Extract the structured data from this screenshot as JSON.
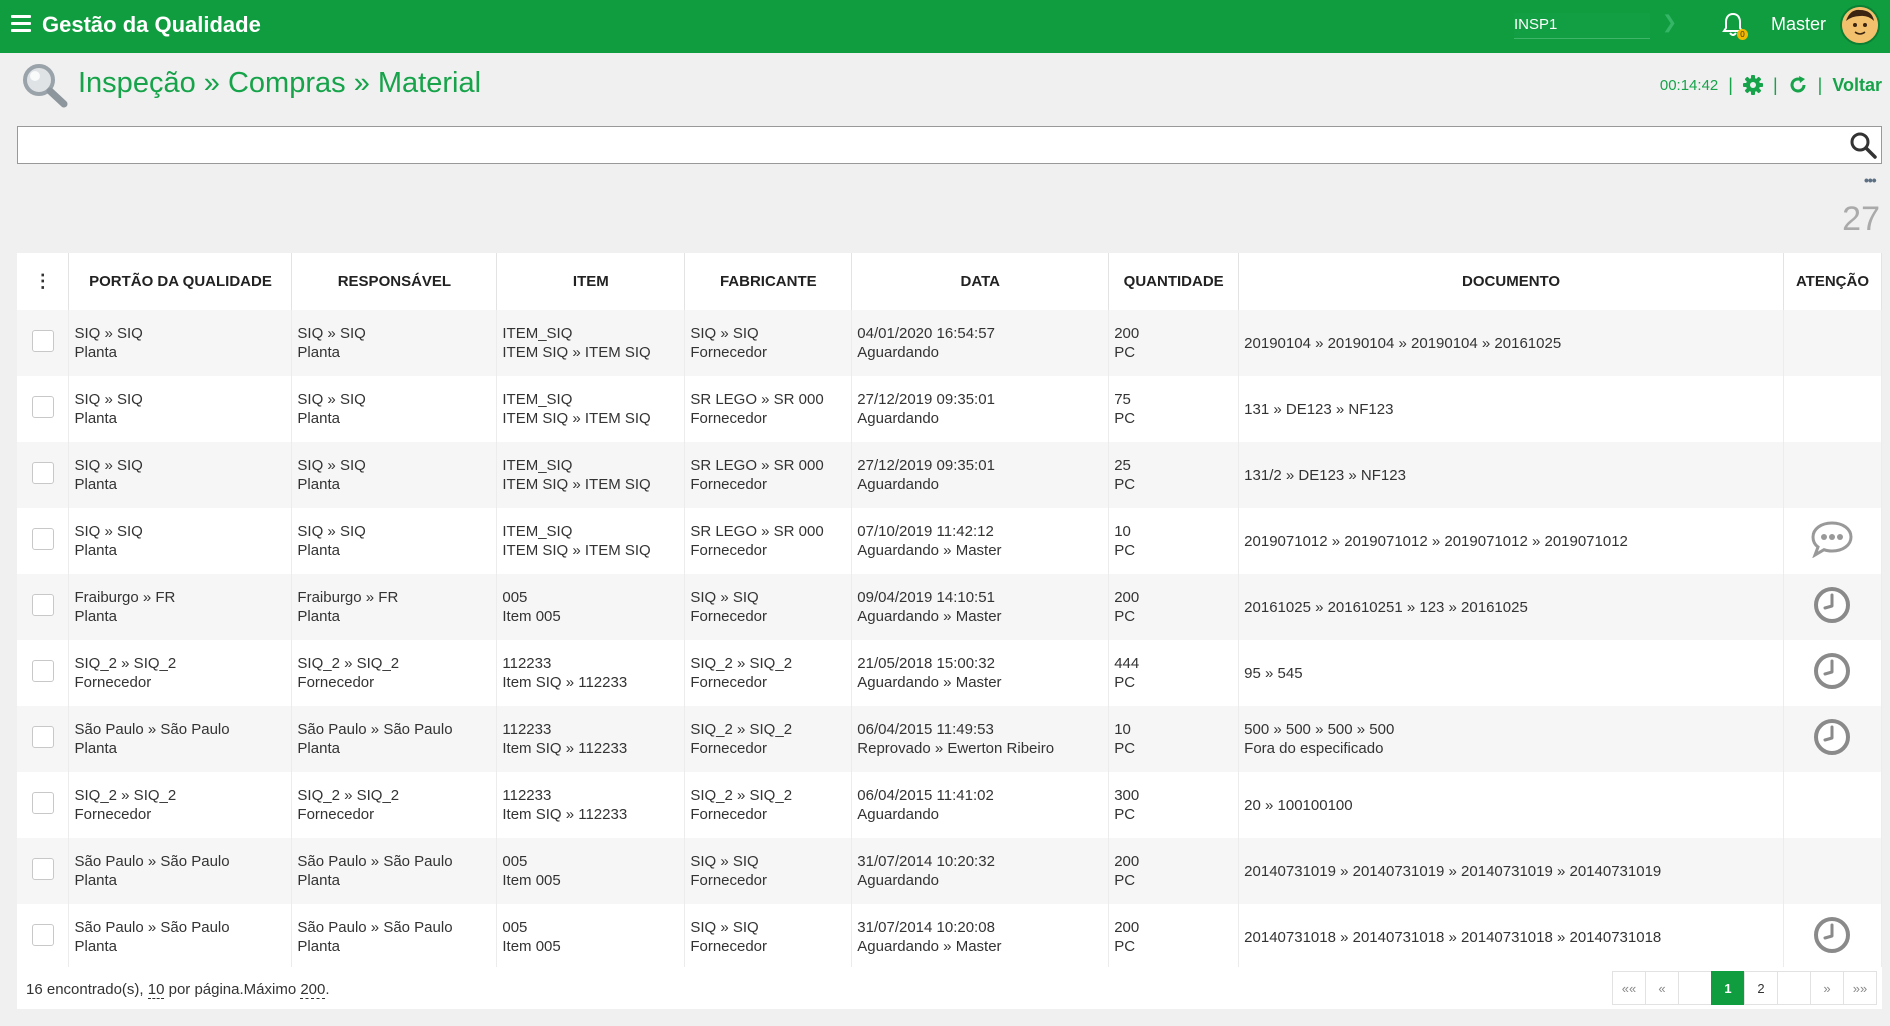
{
  "app": {
    "title": "Gestão da Qualidade"
  },
  "topbar": {
    "context": "INSP1",
    "user": "Master",
    "notifications": "0"
  },
  "breadcrumb": {
    "parts": [
      "Inspeção",
      "Compras",
      "Material"
    ],
    "separator": "»"
  },
  "header": {
    "timer": "00:14:42",
    "sep": "|",
    "back_label": "Voltar"
  },
  "search": {
    "placeholder": "",
    "value": ""
  },
  "more": "•••",
  "total_count": "27",
  "table": {
    "menu_glyph": "⋮",
    "columns": [
      "PORTÃO DA QUALIDADE",
      "RESPONSÁVEL",
      "ITEM",
      "FABRICANTE",
      "DATA",
      "QUANTIDADE",
      "DOCUMENTO",
      "ATENÇÃO"
    ],
    "rows": [
      {
        "portao": [
          "SIQ » SIQ",
          "Planta"
        ],
        "responsavel": [
          "SIQ » SIQ",
          "Planta"
        ],
        "item": [
          "ITEM_SIQ",
          "ITEM SIQ » ITEM SIQ"
        ],
        "fabricante": [
          "SIQ » SIQ",
          "Fornecedor"
        ],
        "data": [
          "04/01/2020 16:54:57",
          "Aguardando"
        ],
        "quantidade": [
          "200",
          "PC"
        ],
        "documento": [
          "20190104 » 20190104 » 20190104 » 20161025"
        ],
        "atencao": ""
      },
      {
        "portao": [
          "SIQ » SIQ",
          "Planta"
        ],
        "responsavel": [
          "SIQ » SIQ",
          "Planta"
        ],
        "item": [
          "ITEM_SIQ",
          "ITEM SIQ » ITEM SIQ"
        ],
        "fabricante": [
          "SR LEGO » SR 000",
          "Fornecedor"
        ],
        "data": [
          "27/12/2019 09:35:01",
          "Aguardando"
        ],
        "quantidade": [
          "75",
          "PC"
        ],
        "documento": [
          "131 » DE123 » NF123"
        ],
        "atencao": ""
      },
      {
        "portao": [
          "SIQ » SIQ",
          "Planta"
        ],
        "responsavel": [
          "SIQ » SIQ",
          "Planta"
        ],
        "item": [
          "ITEM_SIQ",
          "ITEM SIQ » ITEM SIQ"
        ],
        "fabricante": [
          "SR LEGO » SR 000",
          "Fornecedor"
        ],
        "data": [
          "27/12/2019 09:35:01",
          "Aguardando"
        ],
        "quantidade": [
          "25",
          "PC"
        ],
        "documento": [
          "131/2 » DE123 » NF123"
        ],
        "atencao": ""
      },
      {
        "portao": [
          "SIQ » SIQ",
          "Planta"
        ],
        "responsavel": [
          "SIQ » SIQ",
          "Planta"
        ],
        "item": [
          "ITEM_SIQ",
          "ITEM SIQ » ITEM SIQ"
        ],
        "fabricante": [
          "SR LEGO » SR 000",
          "Fornecedor"
        ],
        "data": [
          "07/10/2019 11:42:12",
          "Aguardando » Master"
        ],
        "quantidade": [
          "10",
          "PC"
        ],
        "documento": [
          "2019071012 » 2019071012 » 2019071012 » 2019071012"
        ],
        "atencao": "chat-icon"
      },
      {
        "portao": [
          "Fraiburgo » FR",
          "Planta"
        ],
        "responsavel": [
          "Fraiburgo » FR",
          "Planta"
        ],
        "item": [
          "005",
          "Item 005"
        ],
        "fabricante": [
          "SIQ » SIQ",
          "Fornecedor"
        ],
        "data": [
          "09/04/2019 14:10:51",
          "Aguardando » Master"
        ],
        "quantidade": [
          "200",
          "PC"
        ],
        "documento": [
          "20161025 » 201610251 » 123 » 20161025"
        ],
        "atencao": "clock-icon"
      },
      {
        "portao": [
          "SIQ_2 » SIQ_2",
          "Fornecedor"
        ],
        "responsavel": [
          "SIQ_2 » SIQ_2",
          "Fornecedor"
        ],
        "item": [
          "112233",
          "Item SIQ » 112233"
        ],
        "fabricante": [
          "SIQ_2 » SIQ_2",
          "Fornecedor"
        ],
        "data": [
          "21/05/2018 15:00:32",
          "Aguardando » Master"
        ],
        "quantidade": [
          "444",
          "PC"
        ],
        "documento": [
          "95 » 545"
        ],
        "atencao": "clock-icon"
      },
      {
        "portao": [
          "São Paulo » São Paulo",
          "Planta"
        ],
        "responsavel": [
          "São Paulo » São Paulo",
          "Planta"
        ],
        "item": [
          "112233",
          "Item SIQ » 112233"
        ],
        "fabricante": [
          "SIQ_2 » SIQ_2",
          "Fornecedor"
        ],
        "data": [
          "06/04/2015 11:49:53",
          "Reprovado » Ewerton Ribeiro"
        ],
        "quantidade": [
          "10",
          "PC"
        ],
        "documento": [
          "500 » 500 » 500 » 500",
          "Fora do especificado"
        ],
        "atencao": "clock-icon"
      },
      {
        "portao": [
          "SIQ_2 » SIQ_2",
          "Fornecedor"
        ],
        "responsavel": [
          "SIQ_2 » SIQ_2",
          "Fornecedor"
        ],
        "item": [
          "112233",
          "Item SIQ » 112233"
        ],
        "fabricante": [
          "SIQ_2 » SIQ_2",
          "Fornecedor"
        ],
        "data": [
          "06/04/2015 11:41:02",
          "Aguardando"
        ],
        "quantidade": [
          "300",
          "PC"
        ],
        "documento": [
          "20 » 100100100"
        ],
        "atencao": ""
      },
      {
        "portao": [
          "São Paulo » São Paulo",
          "Planta"
        ],
        "responsavel": [
          "São Paulo » São Paulo",
          "Planta"
        ],
        "item": [
          "005",
          "Item 005"
        ],
        "fabricante": [
          "SIQ » SIQ",
          "Fornecedor"
        ],
        "data": [
          "31/07/2014 10:20:32",
          "Aguardando"
        ],
        "quantidade": [
          "200",
          "PC"
        ],
        "documento": [
          "20140731019 » 20140731019 » 20140731019 » 20140731019"
        ],
        "atencao": ""
      },
      {
        "portao": [
          "São Paulo » São Paulo",
          "Planta"
        ],
        "responsavel": [
          "São Paulo » São Paulo",
          "Planta"
        ],
        "item": [
          "005",
          "Item 005"
        ],
        "fabricante": [
          "SIQ » SIQ",
          "Fornecedor"
        ],
        "data": [
          "31/07/2014 10:20:08",
          "Aguardando » Master"
        ],
        "quantidade": [
          "200",
          "PC"
        ],
        "documento": [
          "20140731018 » 20140731018 » 20140731018 » 20140731018"
        ],
        "atencao": "clock-icon"
      }
    ]
  },
  "footer": {
    "found": "16 encontrado(s), ",
    "per_page_num": "10",
    "per_page_text": " por página.Máximo ",
    "max_num": "200",
    "end": "."
  },
  "pager": {
    "first": "««",
    "prev": "«",
    "pages": [
      "1",
      "2"
    ],
    "active": "1",
    "next": "»",
    "last": "»»"
  },
  "colors": {
    "brand": "#0f9d3f",
    "accent_text": "#16a34a"
  }
}
